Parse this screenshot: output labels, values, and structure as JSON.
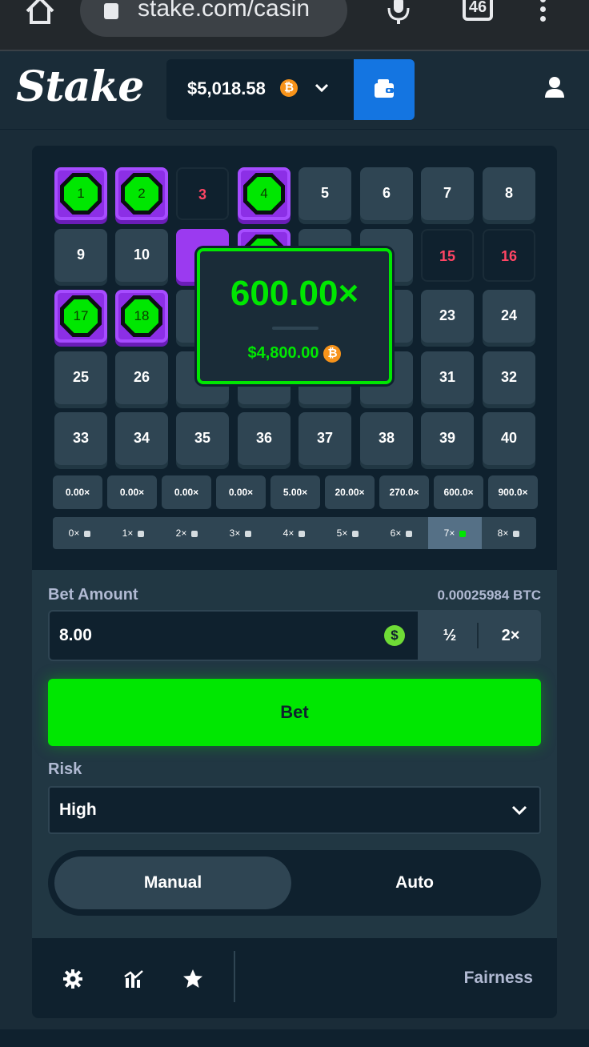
{
  "browser": {
    "url": "stake.com/casin",
    "tab_count": "46"
  },
  "header": {
    "logo_text": "Stake",
    "balance": "$5,018.58",
    "currency_symbol": "₿"
  },
  "board": {
    "tiles": [
      {
        "n": "1",
        "state": "hit"
      },
      {
        "n": "2",
        "state": "hit"
      },
      {
        "n": "3",
        "state": "miss"
      },
      {
        "n": "4",
        "state": "hit"
      },
      {
        "n": "5",
        "state": "normal"
      },
      {
        "n": "6",
        "state": "normal"
      },
      {
        "n": "7",
        "state": "normal"
      },
      {
        "n": "8",
        "state": "normal"
      },
      {
        "n": "9",
        "state": "normal"
      },
      {
        "n": "10",
        "state": "normal"
      },
      {
        "n": "",
        "state": "selected"
      },
      {
        "n": "",
        "state": "hit"
      },
      {
        "n": "",
        "state": "normal"
      },
      {
        "n": "",
        "state": "normal"
      },
      {
        "n": "15",
        "state": "miss"
      },
      {
        "n": "16",
        "state": "miss"
      },
      {
        "n": "17",
        "state": "hit"
      },
      {
        "n": "18",
        "state": "hit"
      },
      {
        "n": "",
        "state": "normal"
      },
      {
        "n": "",
        "state": "normal"
      },
      {
        "n": "",
        "state": "normal"
      },
      {
        "n": "",
        "state": "normal"
      },
      {
        "n": "23",
        "state": "normal"
      },
      {
        "n": "24",
        "state": "normal"
      },
      {
        "n": "25",
        "state": "normal"
      },
      {
        "n": "26",
        "state": "normal"
      },
      {
        "n": "",
        "state": "normal"
      },
      {
        "n": "",
        "state": "normal"
      },
      {
        "n": "",
        "state": "normal"
      },
      {
        "n": "",
        "state": "normal"
      },
      {
        "n": "31",
        "state": "normal"
      },
      {
        "n": "32",
        "state": "normal"
      },
      {
        "n": "33",
        "state": "normal"
      },
      {
        "n": "34",
        "state": "normal"
      },
      {
        "n": "35",
        "state": "normal"
      },
      {
        "n": "36",
        "state": "normal"
      },
      {
        "n": "37",
        "state": "normal"
      },
      {
        "n": "38",
        "state": "normal"
      },
      {
        "n": "39",
        "state": "normal"
      },
      {
        "n": "40",
        "state": "normal"
      }
    ],
    "payouts": [
      "0.00×",
      "0.00×",
      "0.00×",
      "0.00×",
      "5.00×",
      "20.00×",
      "270.0×",
      "600.0×",
      "900.0×"
    ],
    "hits": [
      "0×",
      "1×",
      "2×",
      "3×",
      "4×",
      "5×",
      "6×",
      "7×",
      "8×"
    ],
    "active_hit_index": 7
  },
  "win_popup": {
    "multiplier": "600.00×",
    "amount": "$4,800.00"
  },
  "controls": {
    "bet_label": "Bet Amount",
    "bet_btc": "0.00025984 BTC",
    "bet_value": "8.00",
    "usd_symbol": "$",
    "half_label": "½",
    "double_label": "2×",
    "bet_button": "Bet",
    "risk_label": "Risk",
    "risk_value": "High",
    "mode_manual": "Manual",
    "mode_auto": "Auto",
    "active_mode": "Manual"
  },
  "footer": {
    "fairness": "Fairness"
  },
  "colors": {
    "accent_green": "#00e701",
    "hit_purple": "#8c2fe6",
    "miss_red": "#ff4564",
    "wallet_blue": "#1475e1",
    "panel_dark": "#0f212e",
    "tile_bg": "#2f4553"
  }
}
